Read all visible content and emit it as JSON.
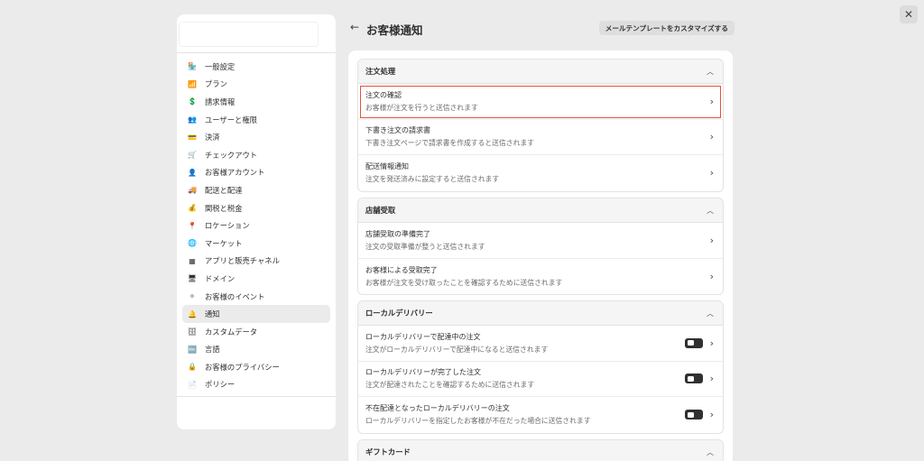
{
  "sidebar": {
    "items": [
      {
        "icon": "store-icon",
        "glyph": "🏪",
        "label": "一般設定"
      },
      {
        "icon": "chart-icon",
        "glyph": "📶",
        "label": "プラン"
      },
      {
        "icon": "billing-icon",
        "glyph": "💲",
        "label": "請求情報"
      },
      {
        "icon": "users-icon",
        "glyph": "👥",
        "label": "ユーザーと権限"
      },
      {
        "icon": "payment-icon",
        "glyph": "💳",
        "label": "決済"
      },
      {
        "icon": "cart-icon",
        "glyph": "🛒",
        "label": "チェックアウト"
      },
      {
        "icon": "person-icon",
        "glyph": "👤",
        "label": "お客様アカウント"
      },
      {
        "icon": "truck-icon",
        "glyph": "🚚",
        "label": "配送と配達"
      },
      {
        "icon": "tax-icon",
        "glyph": "💰",
        "label": "関税と税金"
      },
      {
        "icon": "location-icon",
        "glyph": "📍",
        "label": "ロケーション"
      },
      {
        "icon": "globe-icon",
        "glyph": "🌐",
        "label": "マーケット"
      },
      {
        "icon": "apps-icon",
        "glyph": "▦",
        "label": "アプリと販売チャネル"
      },
      {
        "icon": "domain-icon",
        "glyph": "🖥",
        "label": "ドメイン"
      },
      {
        "icon": "events-icon",
        "glyph": "✧",
        "label": "お客様のイベント"
      },
      {
        "icon": "bell-icon",
        "glyph": "🔔",
        "label": "通知"
      },
      {
        "icon": "database-icon",
        "glyph": "🗄",
        "label": "カスタムデータ"
      },
      {
        "icon": "language-icon",
        "glyph": "🔤",
        "label": "言語"
      },
      {
        "icon": "lock-icon",
        "glyph": "🔒",
        "label": "お客様のプライバシー"
      },
      {
        "icon": "policy-icon",
        "glyph": "📄",
        "label": "ポリシー"
      }
    ],
    "active_index": 14
  },
  "header": {
    "title": "お客様通知",
    "customize_label": "メールテンプレートをカスタマイズする"
  },
  "sections": [
    {
      "title": "注文処理",
      "rows": [
        {
          "title": "注文の確認",
          "desc": "お客様が注文を行うと送信されます",
          "highlighted": true
        },
        {
          "title": "下書き注文の請求書",
          "desc": "下書き注文ページで請求書を作成すると送信されます"
        },
        {
          "title": "配送情報通知",
          "desc": "注文を発送済みに設定すると送信されます"
        }
      ]
    },
    {
      "title": "店舗受取",
      "rows": [
        {
          "title": "店舗受取の準備完了",
          "desc": "注文の受取準備が整うと送信されます"
        },
        {
          "title": "お客様による受取完了",
          "desc": "お客様が注文を受け取ったことを確認するために送信されます"
        }
      ]
    },
    {
      "title": "ローカルデリバリー",
      "rows": [
        {
          "title": "ローカルデリバリーで配達中の注文",
          "desc": "注文がローカルデリバリーで配達中になると送信されます",
          "toggle": true
        },
        {
          "title": "ローカルデリバリーが完了した注文",
          "desc": "注文が配達されたことを確認するために送信されます",
          "toggle": true
        },
        {
          "title": "不在配達となったローカルデリバリーの注文",
          "desc": "ローカルデリバリーを指定したお客様が不在だった場合に送信されます",
          "toggle": true
        }
      ]
    },
    {
      "title": "ギフトカード",
      "rows": []
    }
  ]
}
